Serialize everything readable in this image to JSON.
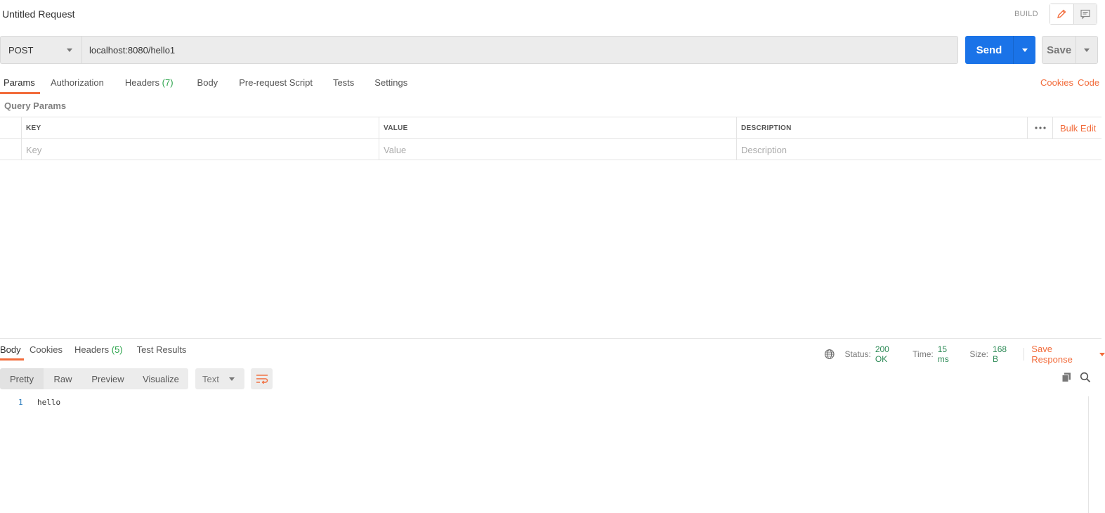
{
  "header": {
    "title": "Untitled Request",
    "mode_label": "BUILD",
    "edit_icon": "pencil-icon",
    "comment_icon": "comment-icon"
  },
  "request": {
    "method": "POST",
    "url": "localhost:8080/hello1",
    "send_label": "Send",
    "save_label": "Save"
  },
  "request_tabs": [
    {
      "label": "Params",
      "count": ""
    },
    {
      "label": "Authorization",
      "count": ""
    },
    {
      "label": "Headers",
      "count": "(7)"
    },
    {
      "label": "Body",
      "count": ""
    },
    {
      "label": "Pre-request Script",
      "count": ""
    },
    {
      "label": "Tests",
      "count": ""
    },
    {
      "label": "Settings",
      "count": ""
    }
  ],
  "request_links": {
    "cookies": "Cookies",
    "code": "Code"
  },
  "query_params": {
    "title": "Query Params",
    "columns": {
      "key": "KEY",
      "value": "VALUE",
      "description": "DESCRIPTION"
    },
    "bulk_edit": "Bulk Edit",
    "placeholders": {
      "key": "Key",
      "value": "Value",
      "description": "Description"
    }
  },
  "response_tabs": [
    {
      "label": "Body",
      "count": ""
    },
    {
      "label": "Cookies",
      "count": ""
    },
    {
      "label": "Headers",
      "count": "(5)"
    },
    {
      "label": "Test Results",
      "count": ""
    }
  ],
  "response_status": {
    "status_label": "Status:",
    "status_value": "200 OK",
    "time_label": "Time:",
    "time_value": "15 ms",
    "size_label": "Size:",
    "size_value": "168 B",
    "save_response": "Save Response"
  },
  "response_view": {
    "formats": [
      "Pretty",
      "Raw",
      "Preview",
      "Visualize"
    ],
    "type": "Text"
  },
  "response_body": {
    "line_number": "1",
    "content": "hello"
  },
  "colors": {
    "accent": "#f26b3a",
    "send_blue": "#1a73e8",
    "status_green": "#2e8b57"
  }
}
